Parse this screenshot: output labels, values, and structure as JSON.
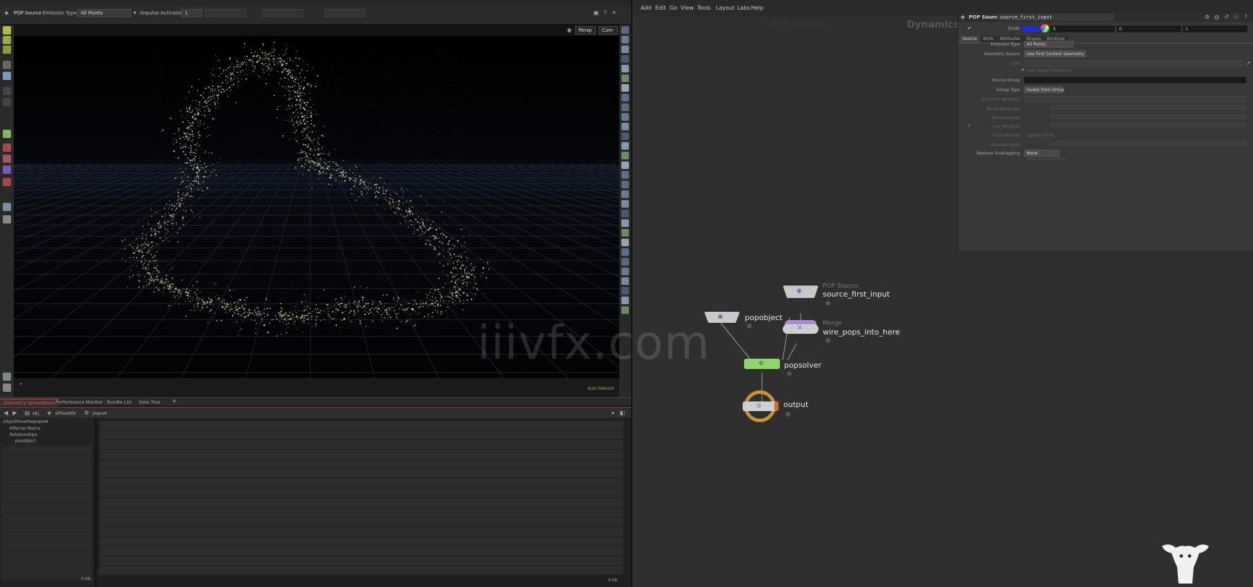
{
  "viewport_toolbar": {
    "node_label": "POP Source",
    "emission_type_label": "Emission Type",
    "emission_type_value": "All Points",
    "impulse_activation_label": "Impulse Activation",
    "impulse_activation_value": "1",
    "persp_label": "Persp",
    "cam_label": "Cam"
  },
  "viewport": {
    "status_text": "Auto Rebuild"
  },
  "lower_panel": {
    "tabs": [
      "Geometry Spreadsheet",
      "Performance Monitor",
      "Bundle List",
      "Data Tree"
    ],
    "path": [
      "obj",
      "silhouette",
      "popnet"
    ],
    "tree_items": [
      "/obj/silhouette/popnet",
      "Affector Matrix",
      "Relationships",
      "popobject"
    ],
    "footer_left": "0 Kb",
    "footer_right": "0 Kb"
  },
  "menubar": {
    "items": [
      "Add",
      "Edit",
      "Go",
      "View",
      "Tools",
      "Layout",
      "Labs",
      "Help"
    ]
  },
  "network": {
    "context_label": "Dynamics",
    "faint_label": "DOP Network",
    "nodes": {
      "source_first_input": {
        "type": "POP Source",
        "name": "source_first_input"
      },
      "popobject": {
        "name": "popobject"
      },
      "wire_pops_into_here": {
        "type": "Merge",
        "name": "wire_pops_into_here"
      },
      "popsolver": {
        "name": "popsolver"
      },
      "output": {
        "name": "output"
      }
    }
  },
  "params": {
    "node_type": "POP Source",
    "node_name": "source_first_input",
    "guide_label": "Guide",
    "guide_values": [
      "0",
      "0",
      "1"
    ],
    "tabs": [
      "Source",
      "Birth",
      "Attributes",
      "Shapes",
      "Bindings"
    ],
    "emission_type_label": "Emission Type",
    "emission_type_value": "All Points",
    "geometry_source_label": "Geometry Source",
    "geometry_source_value": "Use First Context Geometry",
    "sop_label": "SOP",
    "use_object_transform": "Use Object Transform",
    "source_group_label": "Source Group",
    "group_type_label": "Group Type",
    "group_type_value": "Guess from Group",
    "prim_label_1": "Emission Attribute",
    "prim_label_2": "Blend Attributes",
    "prim_label_3": "Attribute Mult",
    "use_attr_label": "Use Attribute",
    "prim_label_4": "Infer Velocity",
    "prim_label_5": "Update Prims",
    "remove_unused_label": "Remove Unused Points",
    "random_seed_label": "Random Seed",
    "remove_overlapping_label": "Remove Overlapping",
    "remove_overlapping_value": "None"
  },
  "colors": {
    "accent_red": "#c44444",
    "node_green": "#8fd46a",
    "node_purple": "#a98bd8",
    "node_output": "#c8913a",
    "guide_blue": "#1a2fd8"
  }
}
